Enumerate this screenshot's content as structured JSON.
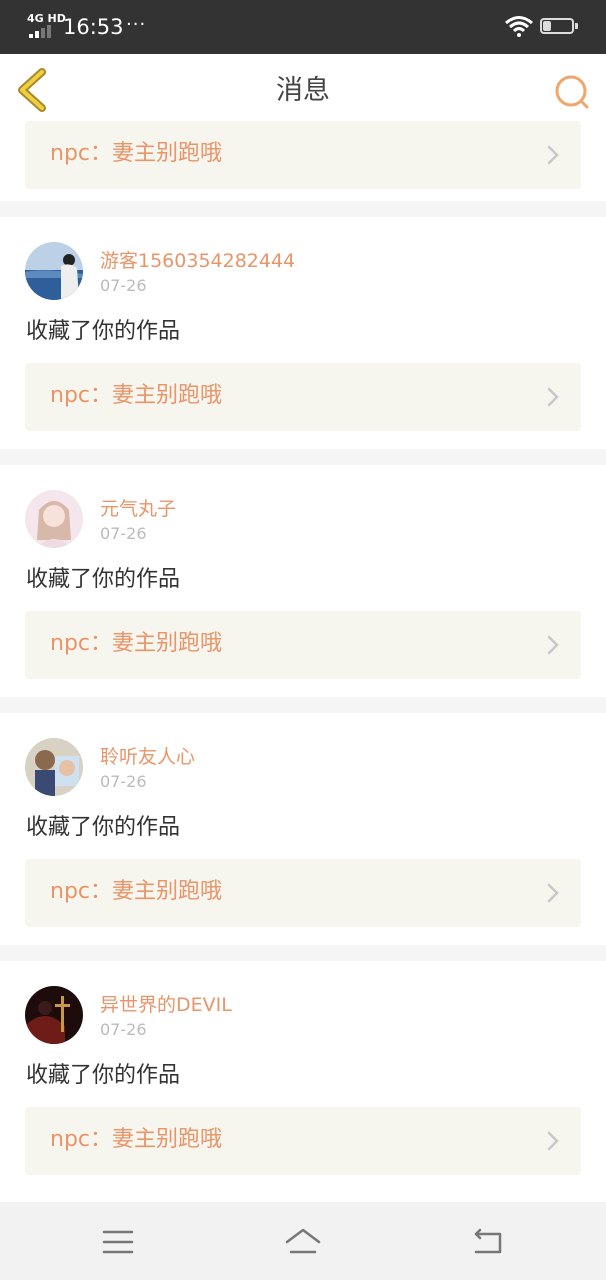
{
  "status_bar": {
    "network": "4G HD",
    "time": "16:53",
    "dots": "···",
    "battery": "26"
  },
  "header": {
    "title": "消息",
    "back_icon": "back-chevron-icon",
    "search_icon": "search-icon"
  },
  "top_partial_card": {
    "work_label": "npc：妻主别跑哦"
  },
  "messages": [
    {
      "user": "游客1560354282444",
      "date": "07-26",
      "action": "收藏了你的作品",
      "work_label": "npc：妻主别跑哦",
      "avatar_colors": [
        "#4d7db5",
        "#cfd9e4"
      ]
    },
    {
      "user": "元气丸子",
      "date": "07-26",
      "action": "收藏了你的作品",
      "work_label": "npc：妻主别跑哦",
      "avatar_colors": [
        "#f3e4ea",
        "#c9a79a"
      ]
    },
    {
      "user": "聆听友人心",
      "date": "07-26",
      "action": "收藏了你的作品",
      "work_label": "npc：妻主别跑哦",
      "avatar_colors": [
        "#7b6a55",
        "#3a4a6a"
      ]
    },
    {
      "user": "异世界的DEVIL",
      "date": "07-26",
      "action": "收藏了你的作品",
      "work_label": "npc：妻主别跑哦",
      "avatar_colors": [
        "#2a1212",
        "#8a2a22"
      ]
    }
  ],
  "nav_bar": {
    "menu_icon": "menu-icon",
    "home_icon": "home-icon",
    "back_icon": "return-icon"
  },
  "colors": {
    "accent": "#e8956a",
    "back_icon": "#e8c33a",
    "card_bg": "#f6f5ee"
  }
}
